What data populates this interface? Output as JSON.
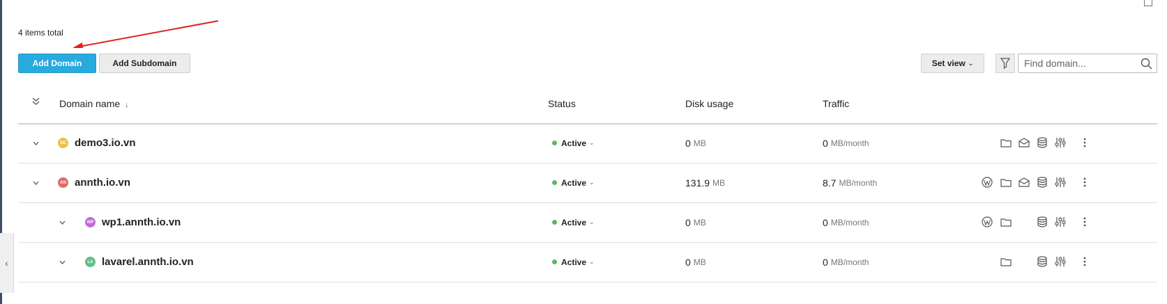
{
  "toolbar": {
    "items_total": "4 items total",
    "add_domain_label": "Add Domain",
    "add_subdomain_label": "Add Subdomain",
    "set_view_label": "Set view",
    "search_placeholder": "Find domain..."
  },
  "columns": {
    "domain_name": "Domain name",
    "status": "Status",
    "disk_usage": "Disk usage",
    "traffic": "Traffic"
  },
  "rows": [
    {
      "initials": "DE",
      "favicon_color": "#e8c24a",
      "name": "demo3.io.vn",
      "status": "Active",
      "disk_value": "0",
      "disk_unit": "MB",
      "traffic_value": "0",
      "traffic_unit": "MB/month",
      "icons": [
        "folder-icon",
        "mail-icon",
        "database-icon",
        "settings-sliders-icon",
        "more-icon"
      ]
    },
    {
      "initials": "AN",
      "favicon_color": "#e06b6b",
      "name": "annth.io.vn",
      "status": "Active",
      "disk_value": "131.9",
      "disk_unit": "MB",
      "traffic_value": "8.7",
      "traffic_unit": "MB/month",
      "icons": [
        "wordpress-icon",
        "folder-icon",
        "mail-icon",
        "database-icon",
        "settings-sliders-icon",
        "more-icon"
      ]
    },
    {
      "initials": "WP",
      "favicon_color": "#c06ad8",
      "name": "wp1.annth.io.vn",
      "status": "Active",
      "disk_value": "0",
      "disk_unit": "MB",
      "traffic_value": "0",
      "traffic_unit": "MB/month",
      "icons": [
        "wordpress-icon",
        "folder-icon",
        "database-icon",
        "settings-sliders-icon",
        "more-icon"
      ]
    },
    {
      "initials": "LA",
      "favicon_color": "#5fbf8a",
      "name": "lavarel.annth.io.vn",
      "status": "Active",
      "disk_value": "0",
      "disk_unit": "MB",
      "traffic_value": "0",
      "traffic_unit": "MB/month",
      "icons": [
        "folder-icon",
        "database-icon",
        "settings-sliders-icon",
        "more-icon"
      ]
    }
  ],
  "colors": {
    "primary": "#28aade",
    "status_active": "#5cb85c",
    "annotation_arrow": "#e02020"
  }
}
